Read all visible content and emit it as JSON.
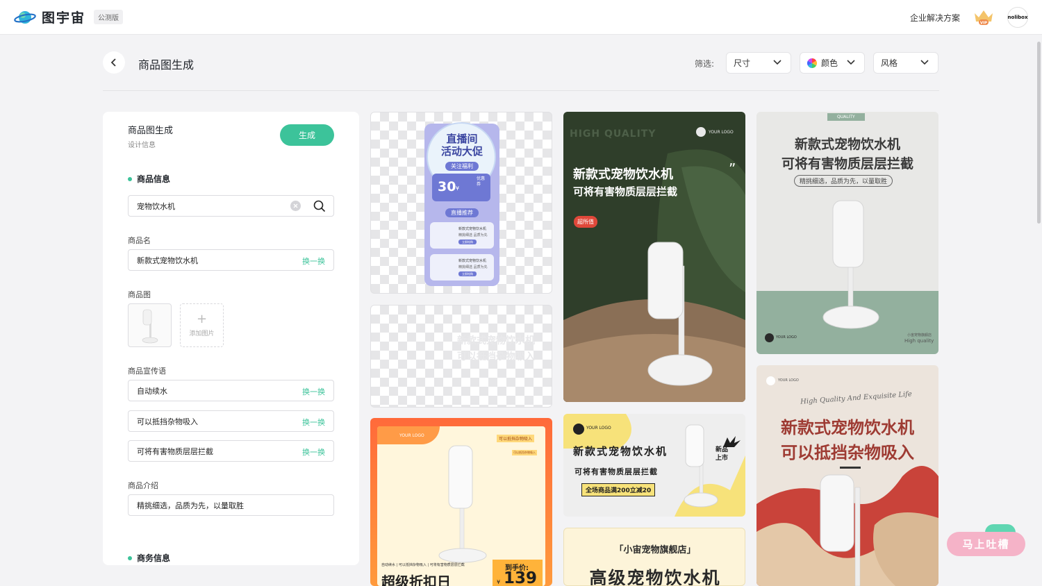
{
  "brand": {
    "name": "图宇宙",
    "badge": "公测版",
    "vip_label": "VIP",
    "avatar_text": "nolibox"
  },
  "header_right": {
    "enterprise": "企业解决方案"
  },
  "page": {
    "title": "商品图生成",
    "filter_label": "筛选:"
  },
  "filters": [
    {
      "label": "尺寸"
    },
    {
      "label": "颜色"
    },
    {
      "label": "风格"
    }
  ],
  "panel": {
    "title": "商品图生成",
    "subtitle": "设计信息",
    "generate": "生成",
    "product_info": {
      "heading": "商品信息",
      "search_value": "宠物饮水机"
    },
    "name": {
      "label": "商品名",
      "value": "新款式宠物饮水机",
      "swap": "换一换"
    },
    "image": {
      "label": "商品图",
      "add_label": "添加图片"
    },
    "slogans": {
      "label": "商品宣传语",
      "items": [
        {
          "value": "自动续水",
          "swap": "换一换"
        },
        {
          "value": "可以抵挡杂物吸入",
          "swap": "换一换"
        },
        {
          "value": "可将有害物质层层拦截",
          "swap": "换一换"
        }
      ]
    },
    "intro": {
      "label": "商品介绍",
      "value": "精挑细选，品质为先，以量取胜"
    },
    "business": {
      "heading": "商务信息"
    }
  },
  "cards": {
    "c1": {
      "title1": "直播间",
      "title2": "活动大促",
      "tag": "关注福利",
      "price": "30",
      "unit": "¥",
      "coupon": "优惠券",
      "rec": "直播推荐",
      "item_title": "新款式宠物饮水机",
      "item_sub": "精挑细选 品质为先",
      "item_btn": "立即抢购"
    },
    "c2": {
      "line1": "新款式宠物饮水机",
      "line2": "可以抵挡杂物吸入"
    },
    "c3": {
      "brand": "YOUR LOGO",
      "small": "可以抵挡杂物吸入",
      "small2": "可以抵挡杂物吸入",
      "strip": "自动续水 | 可以抵挡杂物吸入 | 可将有害物质层层拦截",
      "big": "超级折扣日",
      "price_label": "到手价:",
      "price": "139",
      "currency": "¥"
    },
    "c4": {
      "deco": "HIGH QUALITY",
      "logo": "YOUR LOGO",
      "quote": "”",
      "line1": "新款式宠物饮水机",
      "line2": "可将有害物质层层拦截",
      "tag": "超所值"
    },
    "c5": {
      "logo": "YOUR LOGO",
      "line1": "新款式宠物饮水机",
      "line2": "可将有害物质层层拦截",
      "promo": "全场商品满200立减20",
      "badge": "新品上市"
    },
    "c6": {
      "shop": "「小宙宠物旗舰店」",
      "title": "高级宠物饮水机"
    },
    "c7": {
      "tag": "QUALITY",
      "line1": "新款式宠物饮水机",
      "line2": "可将有害物质层层拦截",
      "pill": "精挑细选，品质为先，以量取胜",
      "logo": "YOUR LOGO",
      "foot1": "小宙宠物旗舰店",
      "foot2": "High quality"
    },
    "c8": {
      "logo": "YOUR LOGO",
      "script": "High Quality And Exquisite Life",
      "line1": "新款式宠物饮水机",
      "line2": "可以抵挡杂物吸入"
    }
  },
  "feedback": "马上吐槽",
  "colors": {
    "accent": "#3cc39a",
    "feedback": "#f5b3c8"
  }
}
